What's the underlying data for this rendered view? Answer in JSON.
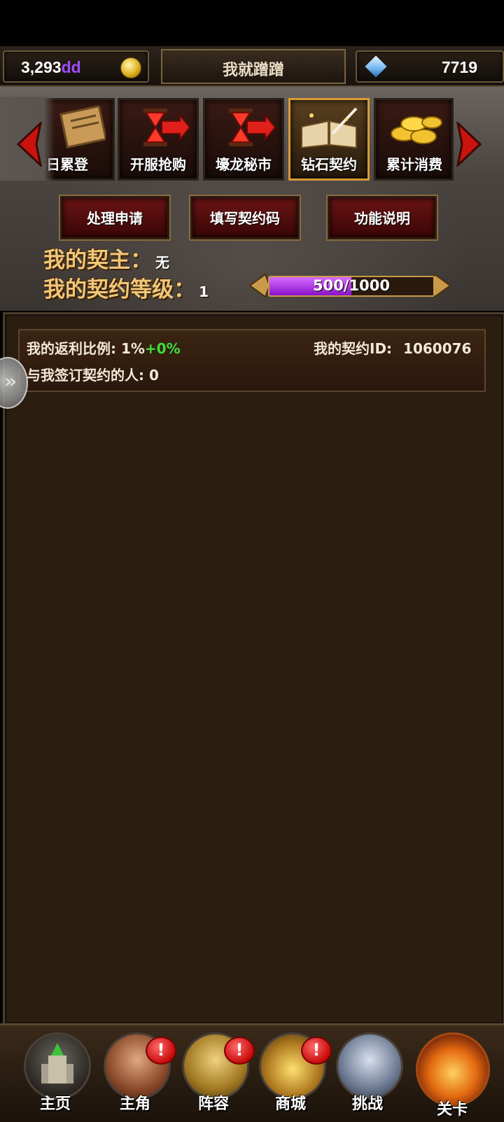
{
  "top_bar": {
    "gold_amount": "3,293",
    "gold_unit": "dd",
    "player_name": "我就蹭蹭",
    "diamond_amount": "7719"
  },
  "event_tabs": [
    {
      "label": "每日累登",
      "icon": "scroll-icon"
    },
    {
      "label": "开服抢购",
      "icon": "hourglass-arrow-icon"
    },
    {
      "label": "壕龙秘市",
      "icon": "hourglass-arrow-icon"
    },
    {
      "label": "钻石契约",
      "icon": "book-quill-icon",
      "active": true
    },
    {
      "label": "累计消费",
      "icon": "gold-coins-icon"
    }
  ],
  "actions": {
    "handle_request": "处理申请",
    "fill_code": "填写契约码",
    "function_desc": "功能说明"
  },
  "contract": {
    "master_label": "我的契主",
    "colon": "：",
    "master_value": "无",
    "level_label": "我的契约等级",
    "level_value": "1",
    "progress_text": "500/1000",
    "progress_value": 0.5
  },
  "info": {
    "rebate_label": "我的返利比例: 1%",
    "rebate_bonus": "+0%",
    "contract_id_label": "我的契约ID:",
    "contract_id": "1060076",
    "signed_label": "与我签订契约的人: 0"
  },
  "side_handle": "»",
  "bottom_nav": [
    {
      "label": "主页",
      "icon": "castle-icon",
      "badge": ""
    },
    {
      "label": "主角",
      "icon": "hero-portrait-icon",
      "badge": "!"
    },
    {
      "label": "阵容",
      "icon": "knight-helmet-icon",
      "badge": "!"
    },
    {
      "label": "商城",
      "icon": "treasure-chest-icon",
      "badge": "!"
    },
    {
      "label": "挑战",
      "icon": "crossed-axes-icon",
      "badge": ""
    },
    {
      "label": "关卡",
      "icon": "fire-emblem-icon",
      "badge": ""
    }
  ],
  "colors": {
    "gold_unit": "#a04cff",
    "rebate_bonus": "#3dde3d",
    "progress_fill": "#b23cf0",
    "panel_bg": "#2b1e10"
  }
}
